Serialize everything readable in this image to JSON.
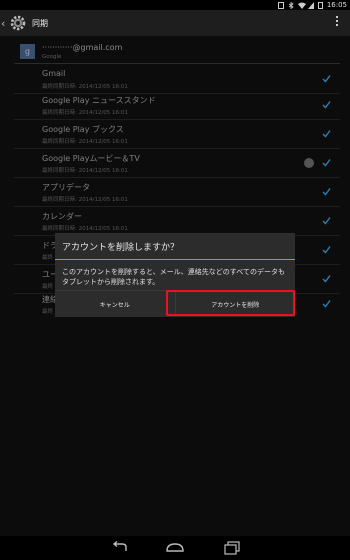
{
  "status": {
    "time": "16:05"
  },
  "actionbar": {
    "title": "同期"
  },
  "account": {
    "email": "············@gmail.com",
    "provider": "Google"
  },
  "sync_items": [
    {
      "title": "Gmail",
      "subtitle": "最終同期日時: 2014/12/05 16:01"
    },
    {
      "title": "Google Play ニューススタンド",
      "subtitle": "最終同期日時: 2014/12/05 16:01"
    },
    {
      "title": "Google Play ブックス",
      "subtitle": "最終同期日時: 2014/12/05 16:01"
    },
    {
      "title": "Google Playムービー＆TV",
      "subtitle": "最終同期日時: 2014/12/05 16:01"
    },
    {
      "title": "アプリデータ",
      "subtitle": "最終同期日時: 2014/12/05 16:01"
    },
    {
      "title": "カレンダー",
      "subtitle": "最終同期日時: 2014/12/05 16:01"
    },
    {
      "title": "ドラ",
      "subtitle": "最終"
    },
    {
      "title": "ユー",
      "subtitle": "最終"
    },
    {
      "title": "連絡",
      "subtitle": "最終"
    }
  ],
  "dialog": {
    "title": "アカウントを削除しますか？",
    "message": "このアカウントを削除すると、メール、連絡先などのすべてのデータもタブレットから削除されます。",
    "cancel_label": "キャンセル",
    "remove_label": "アカウントを削除"
  },
  "colors": {
    "accent": "#33b5e5",
    "highlight": "#e8141d",
    "checkmark": "#2f7fb0"
  }
}
